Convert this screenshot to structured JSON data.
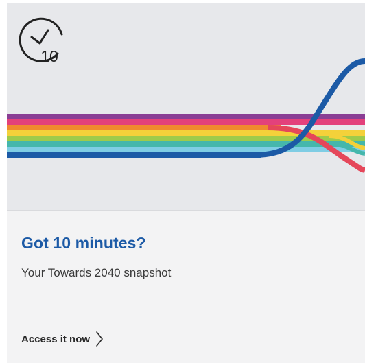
{
  "icon": {
    "name": "timer-10-minutes-icon",
    "number": "10"
  },
  "card": {
    "title": "Got 10 minutes?",
    "subtitle": "Your Towards 2040 snapshot",
    "cta_label": "Access it now",
    "cta_icon": "chevron-right-icon"
  },
  "colors": {
    "hero_background": "#e7e8eb",
    "card_background": "#f3f3f4",
    "title": "#1c5aa6",
    "stripes": [
      "#8a3e94",
      "#e3417b",
      "#f08a2f",
      "#f4d13a",
      "#9ecb4b",
      "#45b7ac",
      "#7fcde4",
      "#1c5aa6"
    ],
    "accent_red": "#e5475a"
  }
}
